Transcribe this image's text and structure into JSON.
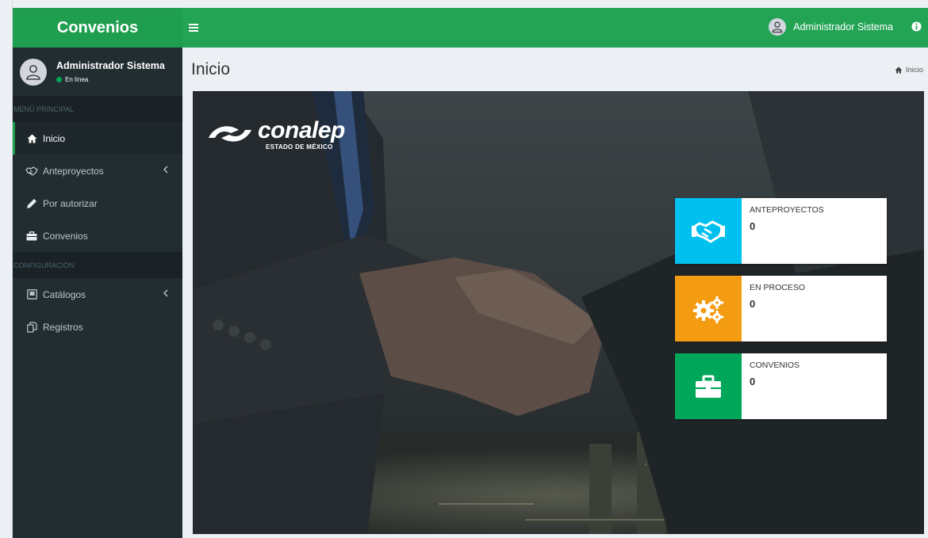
{
  "app": {
    "brand": "Convenios"
  },
  "user": {
    "name": "Administrador Sistema",
    "status": "En línea"
  },
  "sidebar": {
    "sections": [
      {
        "header": "MENÚ PRINCIPAL"
      },
      {
        "header": "CONFIGURACIÓN"
      }
    ],
    "items": [
      {
        "label": "Inicio",
        "icon": "home-icon",
        "active": true
      },
      {
        "label": "Anteproyectos",
        "icon": "handshake-icon",
        "has_submenu": true
      },
      {
        "label": "Por autorizar",
        "icon": "pencil-icon"
      },
      {
        "label": "Convenios",
        "icon": "briefcase-icon"
      },
      {
        "label": "Catálogos",
        "icon": "catalog-icon",
        "has_submenu": true
      },
      {
        "label": "Registros",
        "icon": "copy-icon"
      }
    ]
  },
  "navbar": {
    "user_name": "Administrador Sistema"
  },
  "header": {
    "title": "Inicio",
    "breadcrumb": "Inicio"
  },
  "hero": {
    "logo": {
      "word": "conalep",
      "sub": "ESTADO DE MÉXICO"
    },
    "info_boxes": [
      {
        "label": "ANTEPROYECTOS",
        "value": "0",
        "color": "#00c0ef",
        "icon": "handshake-icon"
      },
      {
        "label": "EN PROCESO",
        "value": "0",
        "color": "#f39c12",
        "icon": "gears-icon"
      },
      {
        "label": "CONVENIOS",
        "value": "0",
        "color": "#00a65a",
        "icon": "briefcase-icon"
      }
    ]
  },
  "colors": {
    "brand": "#1f9e50",
    "navbar": "#23a455",
    "sidebar": "#222d32"
  }
}
